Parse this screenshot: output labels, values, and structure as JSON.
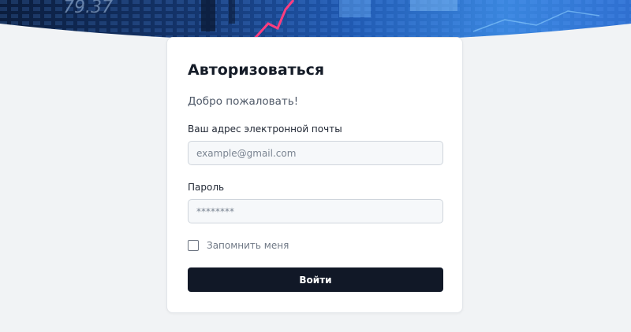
{
  "hero": {
    "overlay_text": "79.37"
  },
  "login": {
    "title": "Авторизоваться",
    "welcome": "Добро пожаловать!",
    "email_label": "Ваш адрес электронной почты",
    "email_placeholder": "example@gmail.com",
    "email_value": "",
    "password_label": "Пароль",
    "password_placeholder": "********",
    "password_value": "",
    "remember_label": "Запомнить меня",
    "remember_checked": false,
    "submit_label": "Войти"
  },
  "colors": {
    "page_background": "#f1f3f5",
    "hero_blue": "#2f6fd0",
    "hero_accent": "#ff3d7f",
    "button": "#111827",
    "card": "#ffffff"
  }
}
